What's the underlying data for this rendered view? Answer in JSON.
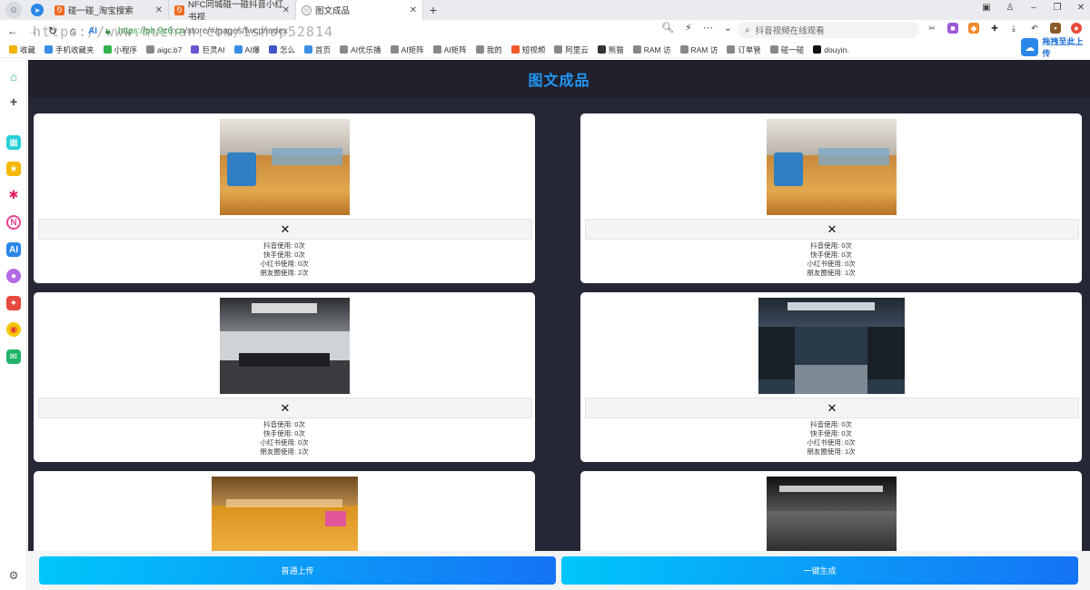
{
  "browser": {
    "avatar_glyph": "☺",
    "tabs": [
      {
        "title": "碰一碰_淘宝搜索",
        "icon": "orange"
      },
      {
        "title": "NFC同城碰一碰抖音小红书视",
        "icon": "orange"
      },
      {
        "title": "图文成品",
        "icon": "gray",
        "active": true
      }
    ],
    "url": "https://ph.9c6.cn/store/#/pages/twcp/index",
    "url_host": "https://ph.9c6.cn",
    "url_path": "/store/#/pages/twcp/index",
    "watermark": "https://www.huzhan.com/1shop52814",
    "search_placeholder": "抖音视频在线观看",
    "upload_float": "拖拽至此上传"
  },
  "bookmarks": [
    {
      "label": "收藏",
      "color": "#f0b400"
    },
    {
      "label": "手机收藏夹",
      "color": "#3a8ee6"
    },
    {
      "label": "小程序",
      "color": "#31b44a"
    },
    {
      "label": "aigc.b7",
      "color": "#888888"
    },
    {
      "label": "巨灵AI",
      "color": "#6b55d3"
    },
    {
      "label": "AI爆",
      "color": "#3a8ee6"
    },
    {
      "label": "怎么",
      "color": "#4255c8"
    },
    {
      "label": "首页",
      "color": "#3a8ee6"
    },
    {
      "label": "AI优乐播",
      "color": "#888888"
    },
    {
      "label": "AI矩阵",
      "color": "#888888"
    },
    {
      "label": "AI矩阵",
      "color": "#888888"
    },
    {
      "label": "我的",
      "color": "#888888"
    },
    {
      "label": "短视频",
      "color": "#f05a28"
    },
    {
      "label": "阿里云",
      "color": "#888888"
    },
    {
      "label": "熊猫",
      "color": "#333333"
    },
    {
      "label": "RAM 访",
      "color": "#888888"
    },
    {
      "label": "RAM 访",
      "color": "#888888"
    },
    {
      "label": "订单管",
      "color": "#888888"
    },
    {
      "label": "碰一碰",
      "color": "#888888"
    },
    {
      "label": "douyin.",
      "color": "#111111"
    }
  ],
  "page": {
    "title": "图文成品",
    "close_glyph": "✕",
    "cards": [
      {
        "photo": "studio",
        "stats": [
          "抖音使用: 0次",
          "快手使用: 0次",
          "小红书使用: 0次",
          "朋友圈使用: 2次"
        ]
      },
      {
        "photo": "studio",
        "stats": [
          "抖音使用: 0次",
          "快手使用: 0次",
          "小红书使用: 0次",
          "朋友圈使用: 1次"
        ]
      },
      {
        "photo": "gym-dark",
        "stats": [
          "抖音使用: 0次",
          "快手使用: 0次",
          "小红书使用: 0次",
          "朋友圈使用: 1次"
        ]
      },
      {
        "photo": "gym-blue",
        "stats": [
          "抖音使用: 0次",
          "快手使用: 0次",
          "小红书使用: 0次",
          "朋友圈使用: 1次"
        ]
      },
      {
        "photo": "studio-warm",
        "stats": []
      },
      {
        "photo": "gym-hall",
        "stats": []
      }
    ],
    "actions": {
      "upload": "普通上传",
      "generate": "一键生成"
    }
  },
  "colors": {
    "accent": "#2196f3",
    "bg": "#262736",
    "button_from": "#00c6fb",
    "button_to": "#1573f5"
  }
}
